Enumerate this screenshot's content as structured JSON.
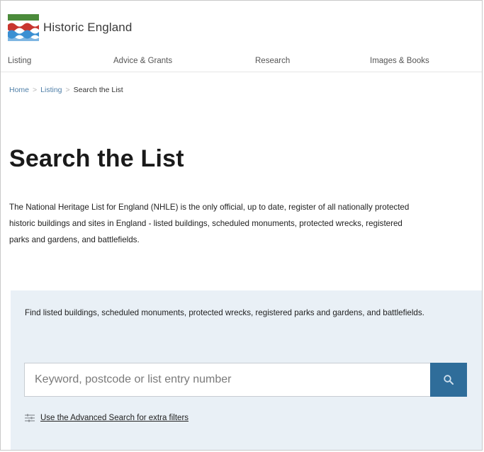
{
  "brand": {
    "name": "Historic England",
    "colors": {
      "red": "#c8362f",
      "green": "#4b8b3b",
      "blue": "#3b8fd2"
    }
  },
  "nav": {
    "items": [
      {
        "label": "Listing"
      },
      {
        "label": "Advice & Grants"
      },
      {
        "label": "Research"
      },
      {
        "label": "Images & Books"
      }
    ]
  },
  "breadcrumb": {
    "home": "Home",
    "listing": "Listing",
    "current": "Search the List",
    "separator": ">"
  },
  "page": {
    "title": "Search the List",
    "intro": "The National Heritage List for England (NHLE) is the only official, up to date, register of all nationally protected historic buildings and sites in England - listed buildings, scheduled monuments, protected wrecks, registered parks and gardens, and battlefields."
  },
  "search": {
    "description": "Find listed buildings, scheduled monuments, protected wrecks, registered parks and gardens, and battlefields.",
    "placeholder": "Keyword, postcode or list entry number",
    "value": "",
    "button_icon": "search-icon",
    "advanced_link": "Use the Advanced Search for extra filters",
    "advanced_icon": "filter-sliders-icon",
    "accent_color": "#2f6d9a",
    "panel_color": "#e9f0f6"
  }
}
